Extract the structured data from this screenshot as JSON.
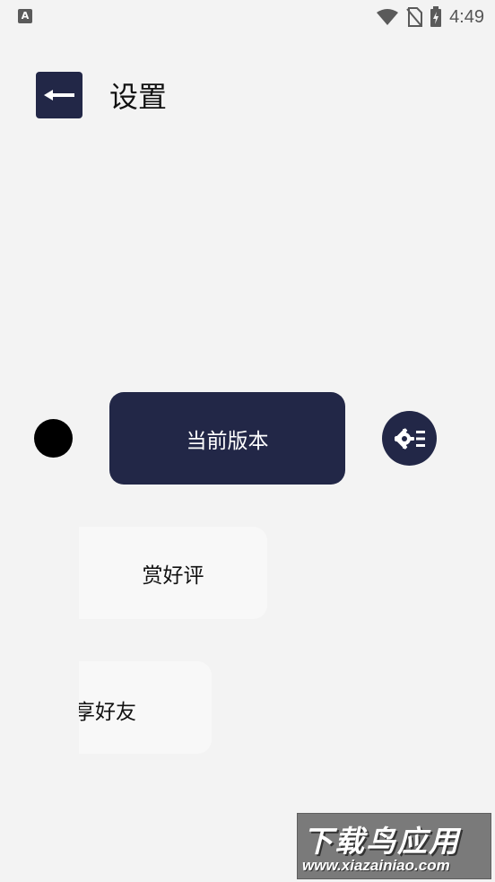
{
  "status_bar": {
    "app_icon_letter": "A",
    "time": "4:49",
    "icons": [
      "wifi-icon",
      "no-sim-icon",
      "battery-charging-icon"
    ]
  },
  "header": {
    "back_icon": "arrow-left-icon",
    "title": "设置"
  },
  "main": {
    "version_label": "当前版本",
    "settings_icon": "gear-list-icon",
    "rate_label": "赏好评",
    "share_label": "享好友"
  },
  "watermark": {
    "title": "下载鸟应用",
    "url": "www.xiazainiao.com"
  },
  "colors": {
    "accent": "#222747",
    "background": "#f3f3f3",
    "card": "#f8f8f8"
  }
}
